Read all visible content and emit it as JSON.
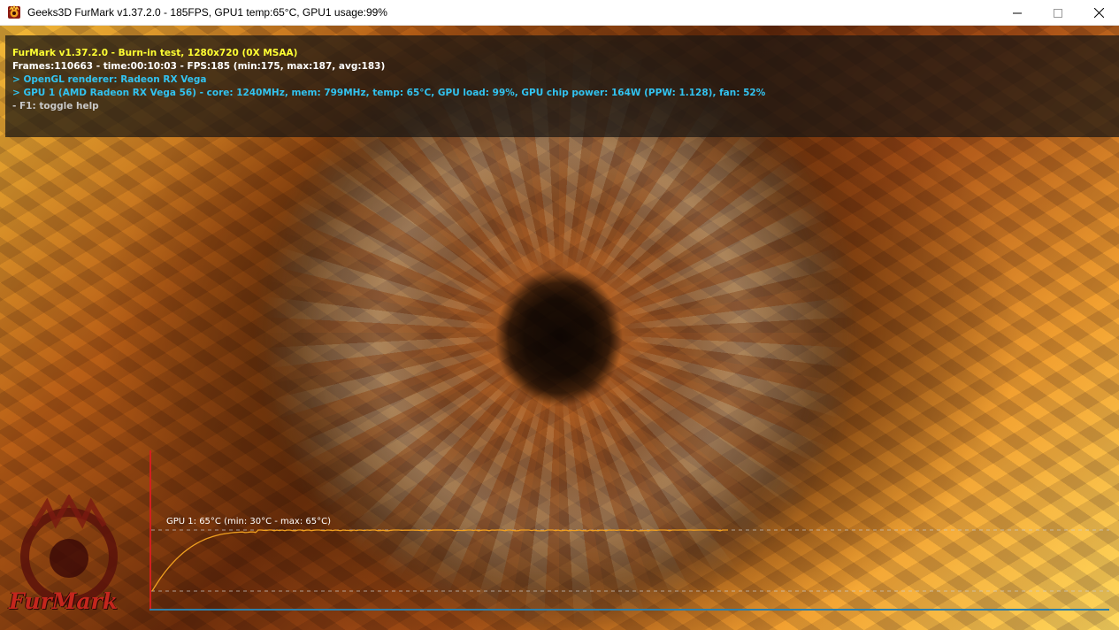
{
  "window": {
    "title": "Geeks3D FurMark v1.37.2.0 - 185FPS, GPU1 temp:65°C, GPU1 usage:99%",
    "controls": {
      "minimize": "minimize-icon",
      "maximize": "maximize-icon",
      "close": "close-icon"
    }
  },
  "overlay": {
    "line1": "FurMark v1.37.2.0 - Burn-in test, 1280x720 (0X MSAA)",
    "line2": "Frames:110663 - time:00:10:03 - FPS:185 (min:175, max:187, avg:183)",
    "line3": "> OpenGL renderer: Radeon RX Vega",
    "line4": "> GPU 1 (AMD Radeon RX Vega 56) - core: 1240MHz, mem: 799MHz, temp: 65°C, GPU load: 99%, GPU chip power: 164W (PPW: 1.128), fan: 52%",
    "line5": "- F1: toggle help",
    "colors": {
      "title": "#ffff33",
      "stats": "#ffffff",
      "gpu": "#32c3f0",
      "help": "#c8c8c8",
      "panel": "#19161480"
    }
  },
  "graph": {
    "label": "GPU 1: 65°C (min: 30°C - max: 65°C)",
    "current_temp_c": 65,
    "min_temp_c": 30,
    "max_temp_c": 65,
    "line_color": "#f0a020",
    "axis_y_color": "#d21f1f",
    "axis_x_color": "#2e7fa8"
  },
  "logo": {
    "text": "FurMark"
  }
}
